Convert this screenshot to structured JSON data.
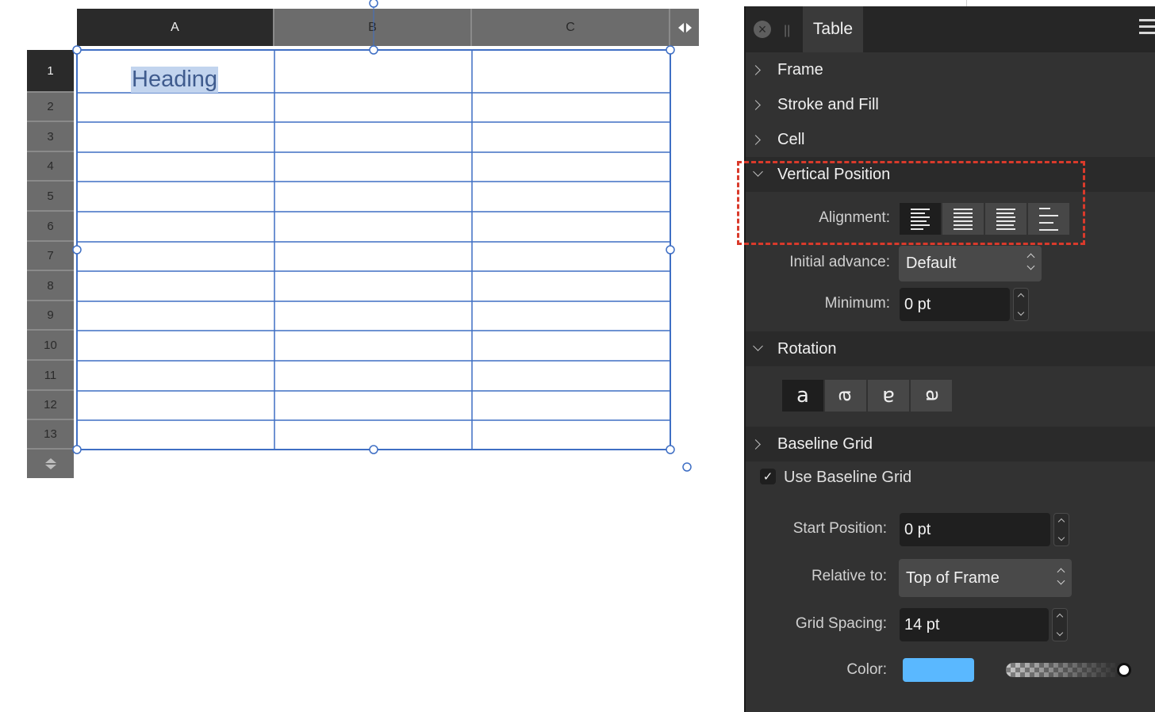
{
  "columns": [
    "A",
    "B",
    "C"
  ],
  "rows": [
    "1",
    "2",
    "3",
    "4",
    "5",
    "6",
    "7",
    "8",
    "9",
    "10",
    "11",
    "12",
    "13"
  ],
  "cell_a1": "Heading",
  "panel": {
    "tab": "Table",
    "sections": {
      "frame": "Frame",
      "stroke_fill": "Stroke and Fill",
      "cell": "Cell",
      "vertical_position": "Vertical Position",
      "rotation": "Rotation",
      "baseline_grid": "Baseline Grid"
    },
    "vertical": {
      "alignment_label": "Alignment:",
      "initial_advance_label": "Initial advance:",
      "initial_advance_value": "Default",
      "minimum_label": "Minimum:",
      "minimum_value": "0 pt"
    },
    "rotation_glyphs": [
      "a",
      "ɐ",
      "ɐ",
      "ɐ"
    ],
    "baseline": {
      "use_label": "Use Baseline Grid",
      "use_checked": true,
      "start_label": "Start Position:",
      "start_value": "0 pt",
      "relative_label": "Relative to:",
      "relative_value": "Top of Frame",
      "spacing_label": "Grid Spacing:",
      "spacing_value": "14 pt",
      "color_label": "Color:",
      "color_value": "#5ab8ff"
    }
  }
}
